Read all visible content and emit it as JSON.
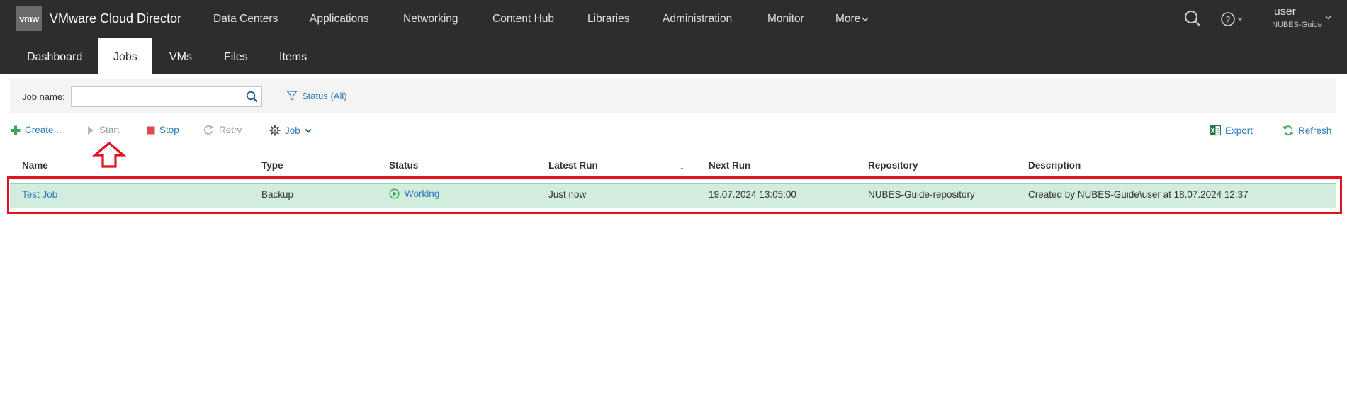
{
  "header": {
    "logo_text": "vmw",
    "app_title": "VMware Cloud Director",
    "nav": [
      "Data Centers",
      "Applications",
      "Networking",
      "Content Hub",
      "Libraries",
      "Administration",
      "Monitor"
    ],
    "more_label": "More",
    "help_icon": "help-icon",
    "search_icon": "search-icon",
    "user": {
      "name": "user",
      "org": "NUBES-Guide"
    }
  },
  "subnav": {
    "tabs": [
      "Dashboard",
      "Jobs",
      "VMs",
      "Files",
      "Items"
    ],
    "active": "Jobs"
  },
  "filter": {
    "job_name_label": "Job name:",
    "job_name_value": "",
    "status_filter_label": "Status (All)"
  },
  "toolbar": {
    "create_label": "Create...",
    "start_label": "Start",
    "stop_label": "Stop",
    "retry_label": "Retry",
    "job_label": "Job",
    "export_label": "Export",
    "refresh_label": "Refresh"
  },
  "table": {
    "columns": [
      "Name",
      "Type",
      "Status",
      "Latest Run",
      "Next Run",
      "Repository",
      "Description"
    ],
    "sort_indicator": "↓",
    "rows": [
      {
        "name": "Test Job",
        "type": "Backup",
        "status": "Working",
        "latest_run": "Just now",
        "next_run": "19.07.2024 13:05:00",
        "repository": "NUBES-Guide-repository",
        "description": "Created by NUBES-Guide\\user at 18.07.2024 12:37"
      }
    ]
  },
  "colors": {
    "header_bg": "#2d2d2d",
    "accent_blue": "#2a7ab8",
    "selected_row": "#d2ecdd",
    "annotation_red": "#e0141e",
    "create_green": "#3aa655",
    "stop_red": "#e04850"
  }
}
